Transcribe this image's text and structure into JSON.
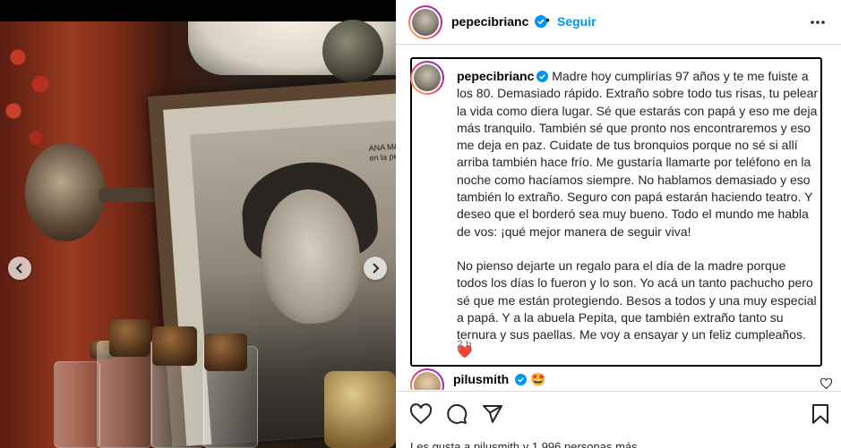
{
  "post": {
    "author": "pepecibrianc",
    "follow_label": "Seguir",
    "separator": "•",
    "verified_icon": "verified-badge-icon",
    "more_icon": "more-options-icon"
  },
  "photo": {
    "caption_line1": "ANA MA",
    "caption_line2": "en la pelíc",
    "prev_icon": "chevron-left-icon",
    "next_icon": "chevron-right-icon"
  },
  "caption": {
    "username": "pepecibrianc",
    "paragraph1": "Madre hoy cumplirías 97 años y te me fuiste a los 80. Demasiado rápido. Extraño sobre todo tus risas, tu pelear la vida como diera lugar. Sé que estarás con papá y eso me deja más tranquilo. También sé que pronto nos encontraremos y eso me deja en paz. Cuidate de tus bronquios porque no sé si allí arriba también hace frío. Me gustaría llamarte por teléfono en la noche como hacíamos siempre. No hablamos demasiado y eso también lo extraño. Seguro con papá estarán haciendo teatro. Y deseo que el borderó sea muy bueno. Todo el mundo me habla de vos: ¡qué mejor manera de seguir viva!",
    "paragraph2": "No pienso dejarte un regalo para el día de la madre porque todos los días lo fueron y lo son. Yo acá un tanto pachucho pero sé que me están protegiendo. Besos a todos y una muy especial a papá. Y a la abuela Pepita, que también extraño tanto su ternura y sus paellas. Me voy a ensayar y un feliz cumpleaños.",
    "heart_emoji": "❤️",
    "time": "2 h"
  },
  "comment": {
    "username": "pilusmith",
    "emoji": "🤩"
  },
  "actions": {
    "like_icon": "heart-icon",
    "comment_icon": "comment-icon",
    "share_icon": "share-icon",
    "save_icon": "bookmark-icon"
  },
  "likes_peek": "Les gusta a pilusmith y 1.996 personas más"
}
